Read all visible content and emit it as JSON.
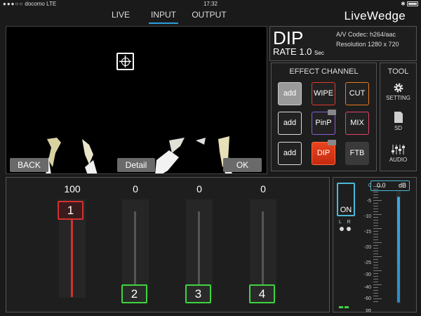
{
  "status_bar": {
    "signal_dots": "●●●○○",
    "carrier": "docomo",
    "network": "LTE",
    "time": "17:32",
    "bluetooth": "✱"
  },
  "nav": {
    "tabs": [
      {
        "label": "LIVE",
        "active": false
      },
      {
        "label": "INPUT",
        "active": true
      },
      {
        "label": "OUTPUT",
        "active": false
      }
    ],
    "brand": "LiveWedge"
  },
  "preview": {
    "back_label": "BACK",
    "detail_label": "Detail",
    "ok_label": "OK"
  },
  "info": {
    "effect_name": "DIP",
    "rate_label": "RATE",
    "rate_value": "1.0",
    "rate_unit": "Sec",
    "codec_line": "A/V Codec:  h264/aac",
    "resolution_line": "Resolution  1280 x 720"
  },
  "effect_channel": {
    "title": "EFFECT CHANNEL",
    "buttons": [
      {
        "label": "add"
      },
      {
        "label": "WIPE"
      },
      {
        "label": "CUT"
      },
      {
        "label": "add"
      },
      {
        "label": "PinP"
      },
      {
        "label": "MIX"
      },
      {
        "label": "add"
      },
      {
        "label": "DIP"
      },
      {
        "label": "FTB"
      }
    ]
  },
  "tool": {
    "title": "TOOL",
    "setting_label": "SETTING",
    "sd_label": "SD",
    "audio_label": "AUDIO"
  },
  "faders": [
    {
      "channel": "1",
      "value": "100",
      "selected": true
    },
    {
      "channel": "2",
      "value": "0",
      "selected": false
    },
    {
      "channel": "3",
      "value": "0",
      "selected": false
    },
    {
      "channel": "4",
      "value": "0",
      "selected": false
    }
  ],
  "audio": {
    "on_label": "ON",
    "lr_label": "L R",
    "db_value": "0.0",
    "db_unit": "dB",
    "scale": [
      "0",
      "-5",
      "-10",
      "-15",
      "-20",
      "-25",
      "-30",
      "-40",
      "-60",
      "∞"
    ],
    "level_fraction": 0.98
  },
  "colors": {
    "accent": "#2a9fe0",
    "fader_selected": "#d43030",
    "fader_idle": "#3fd43f",
    "dip_active": "#e8441e",
    "audio_blue": "#4ab8d8"
  }
}
